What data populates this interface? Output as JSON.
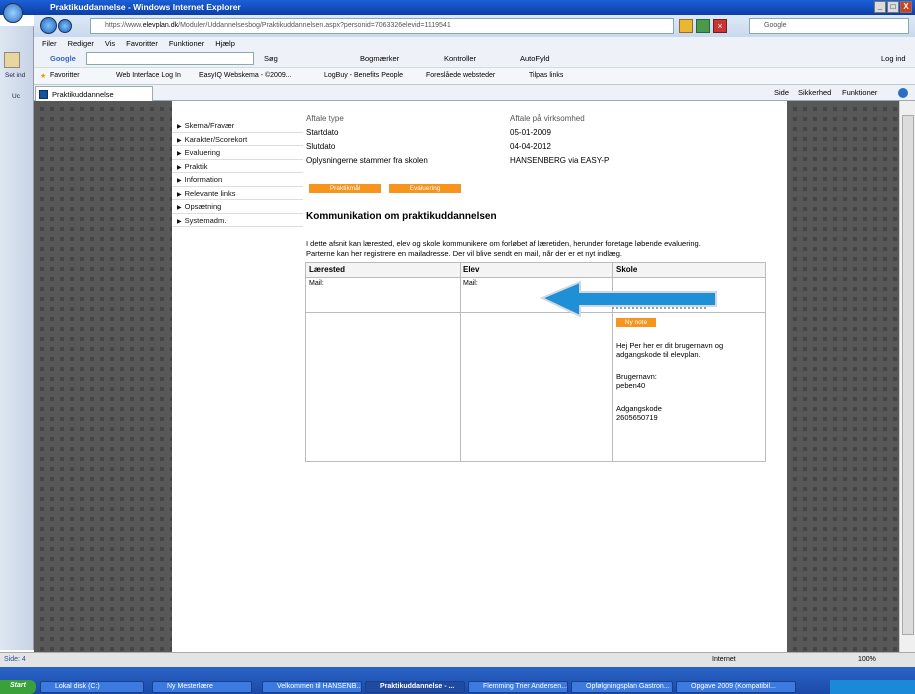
{
  "window": {
    "title": "Praktikuddannelse - Windows Internet Explorer",
    "minimize": "_",
    "restore": "□",
    "close": "X"
  },
  "address": {
    "prefix": "https://www.",
    "domain": "elevplan.dk",
    "path": "/Moduler/Uddannelsesbog/Praktikuddannelsen.aspx?personid=7063326elevid=1119541"
  },
  "search": {
    "placeholder": "Google"
  },
  "left_strip": {
    "label1": "Set ind",
    "label2": "Uc"
  },
  "menu": [
    "Filer",
    "Rediger",
    "Vis",
    "Favoritter",
    "Funktioner",
    "Hjælp"
  ],
  "toolbar": {
    "google": "Google",
    "sog": "Søg",
    "bogmaerker": "Bogmærker",
    "kontroller": "Kontroller",
    "autofyld": "AutoFyld",
    "login": "Log ind"
  },
  "favorites": {
    "label": "Favoritter",
    "items": [
      "Web Interface Log In",
      "EasyIQ Webskema - ©2009...",
      "LogBuy - Benefits People",
      "Foreslåede websteder",
      "Tilpas links"
    ]
  },
  "tab": {
    "label": "Praktikuddannelse"
  },
  "tab_tools": {
    "side": "Side",
    "sikkerhed": "Sikkerhed",
    "funktioner": "Funktioner"
  },
  "sidemenu": [
    "Skema/Fravær",
    "Karakter/Scorekort",
    "Evaluering",
    "Praktik",
    "Information",
    "Relevante links",
    "Opsætning",
    "Systemadm."
  ],
  "info": {
    "aftale_type": "Aftale type",
    "aftale_value": "Aftale på virksomhed",
    "start_label": "Startdato",
    "start_value": "05-01-2009",
    "slut_label": "Slutdato",
    "slut_value": "04-04-2012",
    "oply_label": "Oplysningerne stammer fra skolen",
    "oply_value": "HANSENBERG via EASY-P"
  },
  "buttons": {
    "praktikmaal": "Praktikmål",
    "evaluering": "Evaluering",
    "ny_note": "Ny note"
  },
  "section": {
    "title": "Kommunikation om praktikuddannelsen",
    "desc1": "I dette afsnit kan lærested, elev og skole kommunikere om forløbet af læretiden, herunder foretage løbende evaluering.",
    "desc2": "Parterne kan her registrere en mailadresse. Der vil blive sendt en mail, når der er et nyt indlæg."
  },
  "table": {
    "col1": "Lærested",
    "col2": "Elev",
    "col3": "Skole",
    "mail1": "Mail:",
    "mail2": "Mail:"
  },
  "note": {
    "text": "Hej Per her er dit brugernavn og adgangskode til elevplan.",
    "user_label": "Brugernavn:",
    "user": "peben40",
    "pass_label": "Adgangskode",
    "pass": "2605650719"
  },
  "status": {
    "left": "Side: 4",
    "zone": "Internet",
    "zoom": "100%"
  },
  "taskbar": {
    "start": "Start",
    "items": [
      "Lokal disk (C:)",
      "Ny Mesterlære",
      "Velkommen til HANSENB...",
      "Praktikuddannelse - ...",
      "Flemming Trier Andersen...",
      "Opfølgningsplan Gastron...",
      "Opgave 2009 (Kompatibil..."
    ]
  }
}
